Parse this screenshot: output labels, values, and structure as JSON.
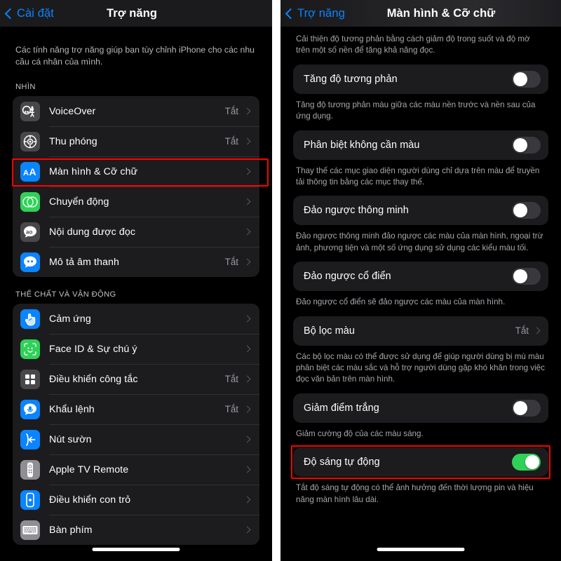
{
  "left": {
    "nav": {
      "back_label": "Cài đặt",
      "title": "Trợ năng",
      "back_icon": "chevron-left-icon"
    },
    "intro": "Các tính năng trợ năng giúp bạn tùy chỉnh iPhone cho các nhu cầu cá nhân của mình.",
    "sections": [
      {
        "header": "NHÌN",
        "items": [
          {
            "label": "VoiceOver",
            "value": "Tắt",
            "icon": "voiceover-icon",
            "icon_color": "#48484a"
          },
          {
            "label": "Thu phóng",
            "value": "Tắt",
            "icon": "zoom-icon",
            "icon_color": "#48484a"
          },
          {
            "label": "Màn hình & Cỡ chữ",
            "value": "",
            "icon": "display-text-size-icon",
            "icon_color": "#0a84ff"
          },
          {
            "label": "Chuyển động",
            "value": "",
            "icon": "motion-icon",
            "icon_color": "#30d158"
          },
          {
            "label": "Nội dung được đọc",
            "value": "",
            "icon": "spoken-content-icon",
            "icon_color": "#48484a"
          },
          {
            "label": "Mô tả âm thanh",
            "value": "Tắt",
            "icon": "audio-description-icon",
            "icon_color": "#0a84ff"
          }
        ]
      },
      {
        "header": "THỂ CHẤT VÀ VẬN ĐỘNG",
        "items": [
          {
            "label": "Cảm ứng",
            "value": "",
            "icon": "touch-icon",
            "icon_color": "#0a84ff"
          },
          {
            "label": "Face ID & Sự chú ý",
            "value": "",
            "icon": "face-id-icon",
            "icon_color": "#30d158"
          },
          {
            "label": "Điều khiển công tắc",
            "value": "Tắt",
            "icon": "switch-control-icon",
            "icon_color": "#48484a"
          },
          {
            "label": "Khẩu lệnh",
            "value": "Tắt",
            "icon": "voice-control-icon",
            "icon_color": "#0a84ff"
          },
          {
            "label": "Nút sườn",
            "value": "",
            "icon": "side-button-icon",
            "icon_color": "#0a84ff"
          },
          {
            "label": "Apple TV Remote",
            "value": "",
            "icon": "apple-tv-remote-icon",
            "icon_color": "#8e8e93"
          },
          {
            "label": "Điều khiển con trỏ",
            "value": "",
            "icon": "pointer-control-icon",
            "icon_color": "#0a84ff"
          },
          {
            "label": "Bàn phím",
            "value": "",
            "icon": "keyboard-icon",
            "icon_color": "#8e8e93"
          }
        ]
      }
    ]
  },
  "right": {
    "nav": {
      "back_label": "Trợ năng",
      "title": "Màn hình & Cỡ chữ",
      "back_icon": "chevron-left-icon"
    },
    "top_desc": "Cải thiện độ tương phản bằng cách giảm độ trong suốt và độ mờ trên một số nền để tăng khả năng đọc.",
    "rows": [
      {
        "label": "Tăng độ tương phản",
        "type": "toggle",
        "state": "off",
        "desc": "Tăng độ tương phản màu giữa các màu nền trước và nền sau của ứng dụng."
      },
      {
        "label": "Phân biệt không cần màu",
        "type": "toggle",
        "state": "off",
        "desc": "Thay thế các mục giao diện người dùng chỉ dựa trên màu để truyền tải thông tin bằng các mục thay thế."
      },
      {
        "label": "Đảo ngược thông minh",
        "type": "toggle",
        "state": "off",
        "desc": "Đảo ngược thông minh đảo ngược các màu của màn hình, ngoại trừ ảnh, phương tiện và một số ứng dụng sử dụng các kiểu màu tối."
      },
      {
        "label": "Đảo ngược cổ điển",
        "type": "toggle",
        "state": "off",
        "desc": "Đảo ngược cổ điển sẽ đảo ngược các màu của màn hình."
      },
      {
        "label": "Bộ lọc màu",
        "type": "link",
        "value": "Tắt",
        "desc": "Các bộ lọc màu có thể được sử dụng để giúp người dùng bị mù màu phân biệt các màu sắc và hỗ trợ người dùng gặp khó khăn trong việc đọc văn bản trên màn hình."
      },
      {
        "label": "Giảm điểm trắng",
        "type": "toggle",
        "state": "off",
        "desc": "Giảm cường độ của các màu sáng."
      },
      {
        "label": "Độ sáng tự động",
        "type": "toggle",
        "state": "on",
        "desc": "Tắt độ sáng tự động có thể ảnh hưởng đến thời lượng pin và hiệu năng màn hình lâu dài."
      }
    ]
  },
  "highlights": {
    "accent_color": "#ff0000",
    "left_target": "Màn hình & Cỡ chữ",
    "right_target": "Độ sáng tự động"
  }
}
